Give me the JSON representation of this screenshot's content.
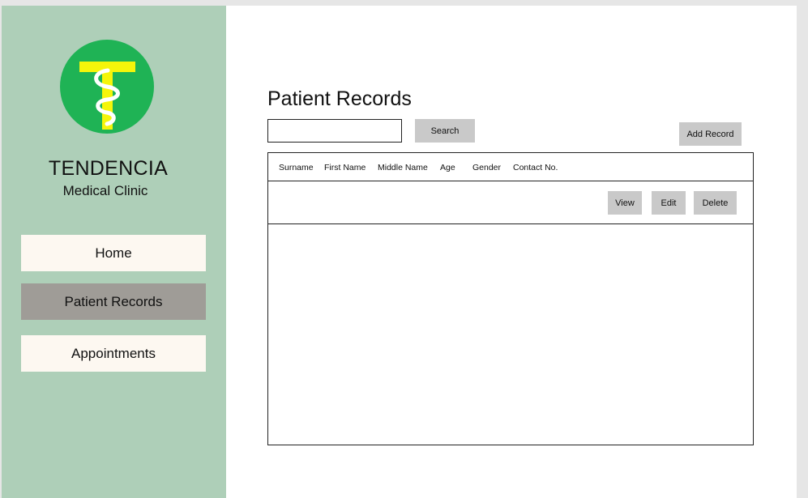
{
  "sidebar": {
    "logo_icon": "rod-of-asclepius-logo-icon",
    "brand_name": "TENDENCIA",
    "brand_subtitle": "Medical Clinic",
    "nav": [
      {
        "label": "Home",
        "active": false
      },
      {
        "label": "Patient Records",
        "active": true
      },
      {
        "label": "Appointments",
        "active": false
      }
    ]
  },
  "main": {
    "title": "Patient Records",
    "search": {
      "value": "",
      "button_label": "Search"
    },
    "add_record_label": "Add Record",
    "table": {
      "columns": [
        "Surname",
        "First Name",
        "Middle Name",
        "Age",
        "Gender",
        "Contact No."
      ],
      "row_actions": {
        "view": "View",
        "edit": "Edit",
        "delete": "Delete"
      }
    }
  },
  "colors": {
    "sidebar_bg": "#aecfb8",
    "nav_bg": "#fdf8f1",
    "nav_active_bg": "#9f9c97",
    "button_bg": "#c9c9c9",
    "logo_green": "#1fb355",
    "logo_yellow": "#f5f50a"
  }
}
